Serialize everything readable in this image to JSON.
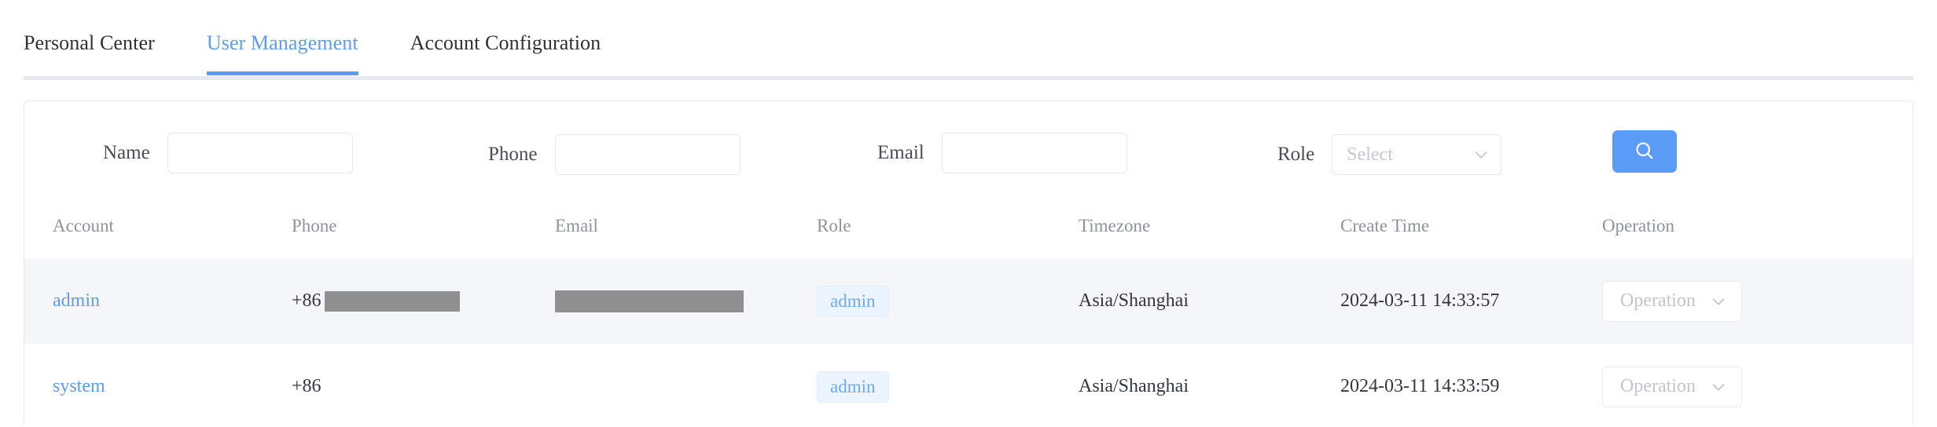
{
  "tabs": [
    {
      "label": "Personal Center",
      "active": false
    },
    {
      "label": "User Management",
      "active": true
    },
    {
      "label": "Account Configuration",
      "active": false
    }
  ],
  "filters": {
    "name": {
      "label": "Name",
      "value": "",
      "placeholder": ""
    },
    "phone": {
      "label": "Phone",
      "value": "",
      "placeholder": ""
    },
    "email": {
      "label": "Email",
      "value": "",
      "placeholder": ""
    },
    "role": {
      "label": "Role",
      "value": "",
      "placeholder": "Select"
    },
    "search_button_icon": "search-icon"
  },
  "table": {
    "columns": [
      "Account",
      "Phone",
      "Email",
      "Role",
      "Timezone",
      "Create Time",
      "Operation"
    ],
    "rows": [
      {
        "account": "admin",
        "phone": "+86",
        "phone_redacted": true,
        "email": "",
        "email_redacted": true,
        "role": "admin",
        "timezone": "Asia/Shanghai",
        "create_time": "2024-03-11 14:33:57",
        "operation": "Operation"
      },
      {
        "account": "system",
        "phone": "+86",
        "phone_redacted": false,
        "email": "",
        "email_redacted": false,
        "role": "admin",
        "timezone": "Asia/Shanghai",
        "create_time": "2024-03-11 14:33:59",
        "operation": "Operation"
      }
    ]
  },
  "colors": {
    "accent": "#5b9cf8",
    "tag_bg": "#ecf5ff",
    "tag_text": "#6aa9f5",
    "row_striped": "#f4f6fa",
    "border": "#e6e8eb",
    "redaction": "#8f8f8f"
  }
}
